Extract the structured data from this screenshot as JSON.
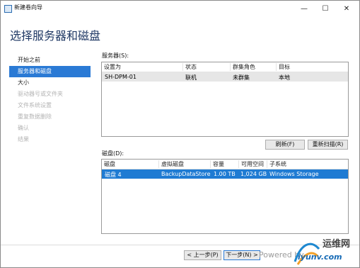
{
  "window": {
    "title": "新建卷向导",
    "minimize": "—",
    "maximize": "☐",
    "close": "✕"
  },
  "heading": "选择服务器和磁盘",
  "nav": [
    {
      "label": "开始之前",
      "state": "normal"
    },
    {
      "label": "服务器和磁盘",
      "state": "selected"
    },
    {
      "label": "大小",
      "state": "normal"
    },
    {
      "label": "驱动器号或文件夹",
      "state": "disabled"
    },
    {
      "label": "文件系统设置",
      "state": "disabled"
    },
    {
      "label": "重复数据删除",
      "state": "disabled"
    },
    {
      "label": "确认",
      "state": "disabled"
    },
    {
      "label": "结果",
      "state": "disabled"
    }
  ],
  "servers": {
    "label": "服务器(S):",
    "columns": [
      "设置为",
      "状态",
      "群集角色",
      "目标"
    ],
    "rows": [
      {
        "name": "SH-DPM-01",
        "status": "联机",
        "role": "未群集",
        "target": "本地"
      }
    ]
  },
  "buttons": {
    "refresh": "刷新(F)",
    "rescan": "重新扫描(R)",
    "prev": "< 上一步(P)",
    "next": "下一步(N) >"
  },
  "disks": {
    "label": "磁盘(D):",
    "columns": [
      "磁盘",
      "虚拟磁盘",
      "容量",
      "可用空间",
      "子系统"
    ],
    "rows": [
      {
        "disk": "磁盘 4",
        "vdisk": "BackupDataStore",
        "capacity": "1.00 TB",
        "free": "1,024 GB",
        "subsystem": "Windows Storage"
      }
    ]
  },
  "watermark": {
    "brand": "运维网",
    "url": "iyunv.com",
    "powered": "Powered by"
  },
  "colors": {
    "accent": "#2a7ad5",
    "heading": "#1f3864"
  }
}
